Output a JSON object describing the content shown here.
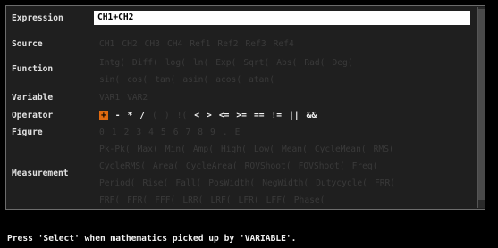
{
  "labels": {
    "expression": "Expression",
    "source": "Source",
    "function": "Function",
    "variable": "Variable",
    "operator": "Operator",
    "figure": "Figure",
    "measurement": "Measurement"
  },
  "expression_value": "CH1+CH2",
  "source": [
    "CH1",
    "CH2",
    "CH3",
    "CH4",
    "Ref1",
    "Ref2",
    "Ref3",
    "Ref4"
  ],
  "function_row1": [
    "Intg(",
    "Diff(",
    "log(",
    "ln(",
    "Exp(",
    "Sqrt(",
    "Abs(",
    "Rad(",
    "Deg("
  ],
  "function_row2": [
    "sin(",
    "cos(",
    "tan(",
    "asin(",
    "acos(",
    "atan("
  ],
  "variable": [
    "VAR1",
    "VAR2"
  ],
  "operator_dim": [
    "-",
    "*",
    "/",
    "(",
    ")",
    "!("
  ],
  "operator_selected": "+",
  "operator_active": [
    "<",
    ">",
    "<=",
    ">=",
    "==",
    "!=",
    "||",
    "&&"
  ],
  "figure": [
    "0",
    "1",
    "2",
    "3",
    "4",
    "5",
    "6",
    "7",
    "8",
    "9",
    ".",
    "E"
  ],
  "measurement_row1": [
    "Pk-Pk(",
    "Max(",
    "Min(",
    "Amp(",
    "High(",
    "Low(",
    "Mean(",
    "CycleMean(",
    "RMS("
  ],
  "measurement_row2": [
    "CycleRMS(",
    "Area(",
    "CycleArea(",
    "ROVShoot(",
    "FOVShoot(",
    "Freq("
  ],
  "measurement_row3": [
    "Period(",
    "Rise(",
    "Fall(",
    "PosWidth(",
    "NegWidth(",
    "Dutycycle(",
    "FRR("
  ],
  "measurement_row4": [
    "FRF(",
    "FFR(",
    "FFF(",
    "LRR(",
    "LRF(",
    "LFR(",
    "LFF(",
    "Phase("
  ],
  "status": "Press 'Select' when mathematics picked up by 'VARIABLE'.",
  "colors": {
    "selected": "#e06a10",
    "dim_text": "#3a3a3a",
    "active_text": "#f2f2f2"
  }
}
